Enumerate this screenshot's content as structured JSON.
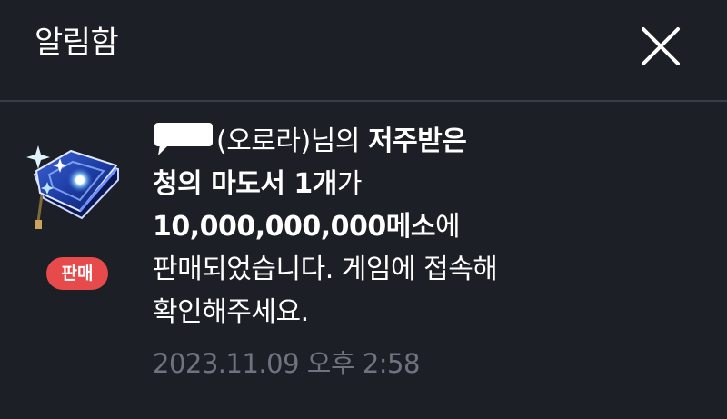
{
  "header": {
    "title": "알림함",
    "close_icon": "close-icon"
  },
  "notification": {
    "badge": "판매",
    "item_icon": "spellbook-icon",
    "message": {
      "line1_name": "(오로라)",
      "line1_suffix": "님의",
      "line1_item_start": "저주받은",
      "line2_item": "청의 마도서 1개",
      "line2_suffix": "가",
      "line3_amount": "10,000,000,000메소",
      "line3_suffix": "에",
      "line4": "판매되었습니다. 게임에 접속해",
      "line5": "확인해주세요."
    },
    "timestamp": "2023.11.09 오후 2:58"
  },
  "colors": {
    "background": "#1d1f27",
    "divider": "#3a3d47",
    "badge": "#e74a4a",
    "timestamp": "#6f7380",
    "text": "#ffffff"
  }
}
